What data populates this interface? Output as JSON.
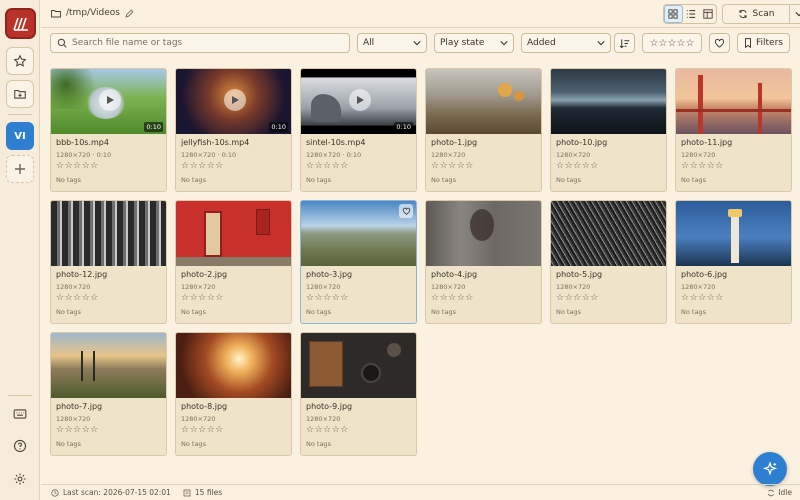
{
  "app": {
    "accent": "#2f7fd0",
    "brand": "#b8322a"
  },
  "rail": {
    "logo_icon": "logo-icon",
    "favorites_icon": "star-icon",
    "open_folder_icon": "folder-open-icon",
    "library_avatar": "VI",
    "add_library_icon": "plus-icon",
    "keyboard_icon": "keyboard-icon",
    "help_icon": "help-icon",
    "settings_icon": "gear-icon"
  },
  "header": {
    "path": "/tmp/Videos",
    "scan_label": "Scan"
  },
  "toolbar": {
    "search_placeholder": "Search file name or tags",
    "type_filter": "All",
    "play_state_filter": "Play state",
    "sort_by": "Added",
    "rating_filter": "☆☆☆☆☆",
    "filters_label": "Filters"
  },
  "items": [
    {
      "name": "bbb-10s.mp4",
      "dims": "1280×720 · 0:10",
      "duration": "0:10",
      "stars": "☆☆☆☆☆",
      "tags": "No tags"
    },
    {
      "name": "jellyfish-10s.mp4",
      "dims": "1280×720 · 0:10",
      "duration": "0:10",
      "stars": "☆☆☆☆☆",
      "tags": "No tags"
    },
    {
      "name": "sintel-10s.mp4",
      "dims": "1280×720 · 0:10",
      "duration": "0:10",
      "stars": "☆☆☆☆☆",
      "tags": "No tags"
    },
    {
      "name": "photo-1.jpg",
      "dims": "1280×720",
      "stars": "☆☆☆☆☆",
      "tags": "No tags"
    },
    {
      "name": "photo-10.jpg",
      "dims": "1280×720",
      "stars": "☆☆☆☆☆",
      "tags": "No tags"
    },
    {
      "name": "photo-11.jpg",
      "dims": "1280×720",
      "stars": "☆☆☆☆☆",
      "tags": "No tags"
    },
    {
      "name": "photo-12.jpg",
      "dims": "1280×720",
      "stars": "☆☆☆☆☆",
      "tags": "No tags"
    },
    {
      "name": "photo-2.jpg",
      "dims": "1280×720",
      "stars": "☆☆☆☆☆",
      "tags": "No tags"
    },
    {
      "name": "photo-3.jpg",
      "dims": "1280×720",
      "stars": "☆☆☆☆☆",
      "tags": "No tags"
    },
    {
      "name": "photo-4.jpg",
      "dims": "1280×720",
      "stars": "☆☆☆☆☆",
      "tags": "No tags"
    },
    {
      "name": "photo-5.jpg",
      "dims": "1280×720",
      "stars": "☆☆☆☆☆",
      "tags": "No tags"
    },
    {
      "name": "photo-6.jpg",
      "dims": "1280×720",
      "stars": "☆☆☆☆☆",
      "tags": "No tags"
    },
    {
      "name": "photo-7.jpg",
      "dims": "1280×720",
      "stars": "☆☆☆☆☆",
      "tags": "No tags"
    },
    {
      "name": "photo-8.jpg",
      "dims": "1280×720",
      "stars": "☆☆☆☆☆",
      "tags": "No tags"
    },
    {
      "name": "photo-9.jpg",
      "dims": "1280×720",
      "stars": "☆☆☆☆☆",
      "tags": "No tags"
    }
  ],
  "status": {
    "last_scan": "Last scan: 2026-07-15 02:01",
    "file_count": "15 files",
    "state": "Idle"
  },
  "fab_icon": "sparkle-icon"
}
